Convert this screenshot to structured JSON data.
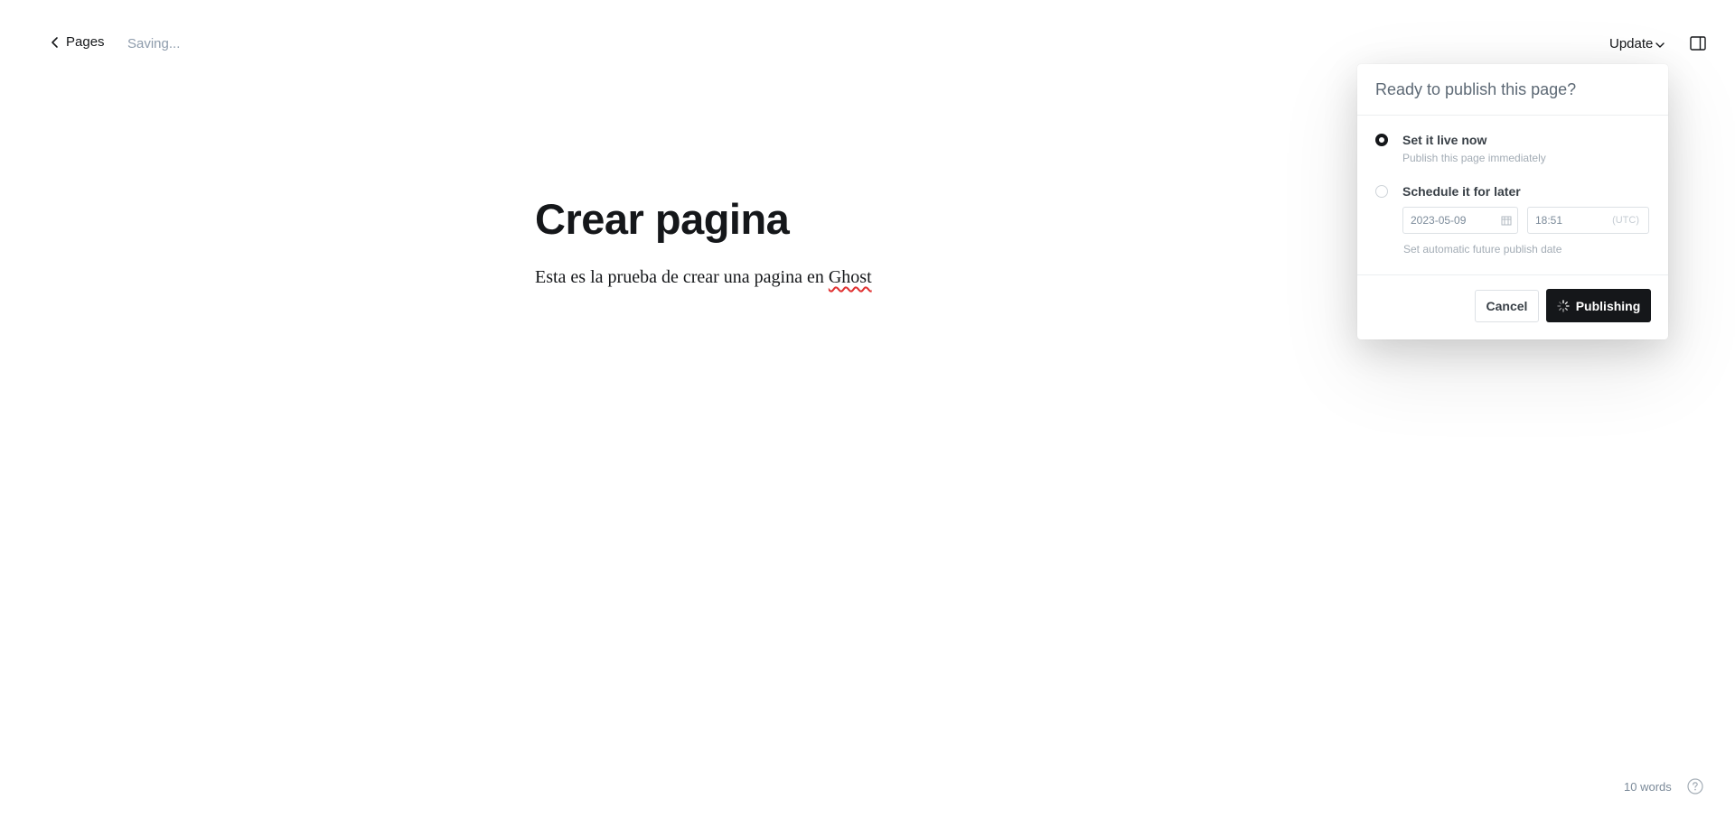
{
  "header": {
    "back_label": "Pages",
    "status": "Saving...",
    "update_label": "Update",
    "icons": {
      "back": "chevron-left-icon",
      "update": "chevron-down-icon",
      "sidebar": "sidebar-toggle-icon"
    }
  },
  "editor": {
    "title": "Crear pagina",
    "body_before": "Esta es la prueba de crear una pagina en ",
    "body_misspelled": "Ghost"
  },
  "publish_menu": {
    "heading": "Ready to publish this page?",
    "options": [
      {
        "label": "Set it live now",
        "description": "Publish this page immediately",
        "selected": true
      },
      {
        "label": "Schedule it for later",
        "description": "",
        "selected": false
      }
    ],
    "schedule": {
      "date": "2023-05-09",
      "time": "18:51",
      "timezone": "(UTC)",
      "hint": "Set automatic future publish date"
    },
    "cancel_label": "Cancel",
    "publish_label": "Publishing"
  },
  "footer": {
    "word_count": "10 words",
    "help_icon": "help-circle-icon"
  },
  "colors": {
    "text": "#15171a",
    "muted": "#8e9cac",
    "button_dark": "#15171a",
    "border": "#dde1e5"
  }
}
